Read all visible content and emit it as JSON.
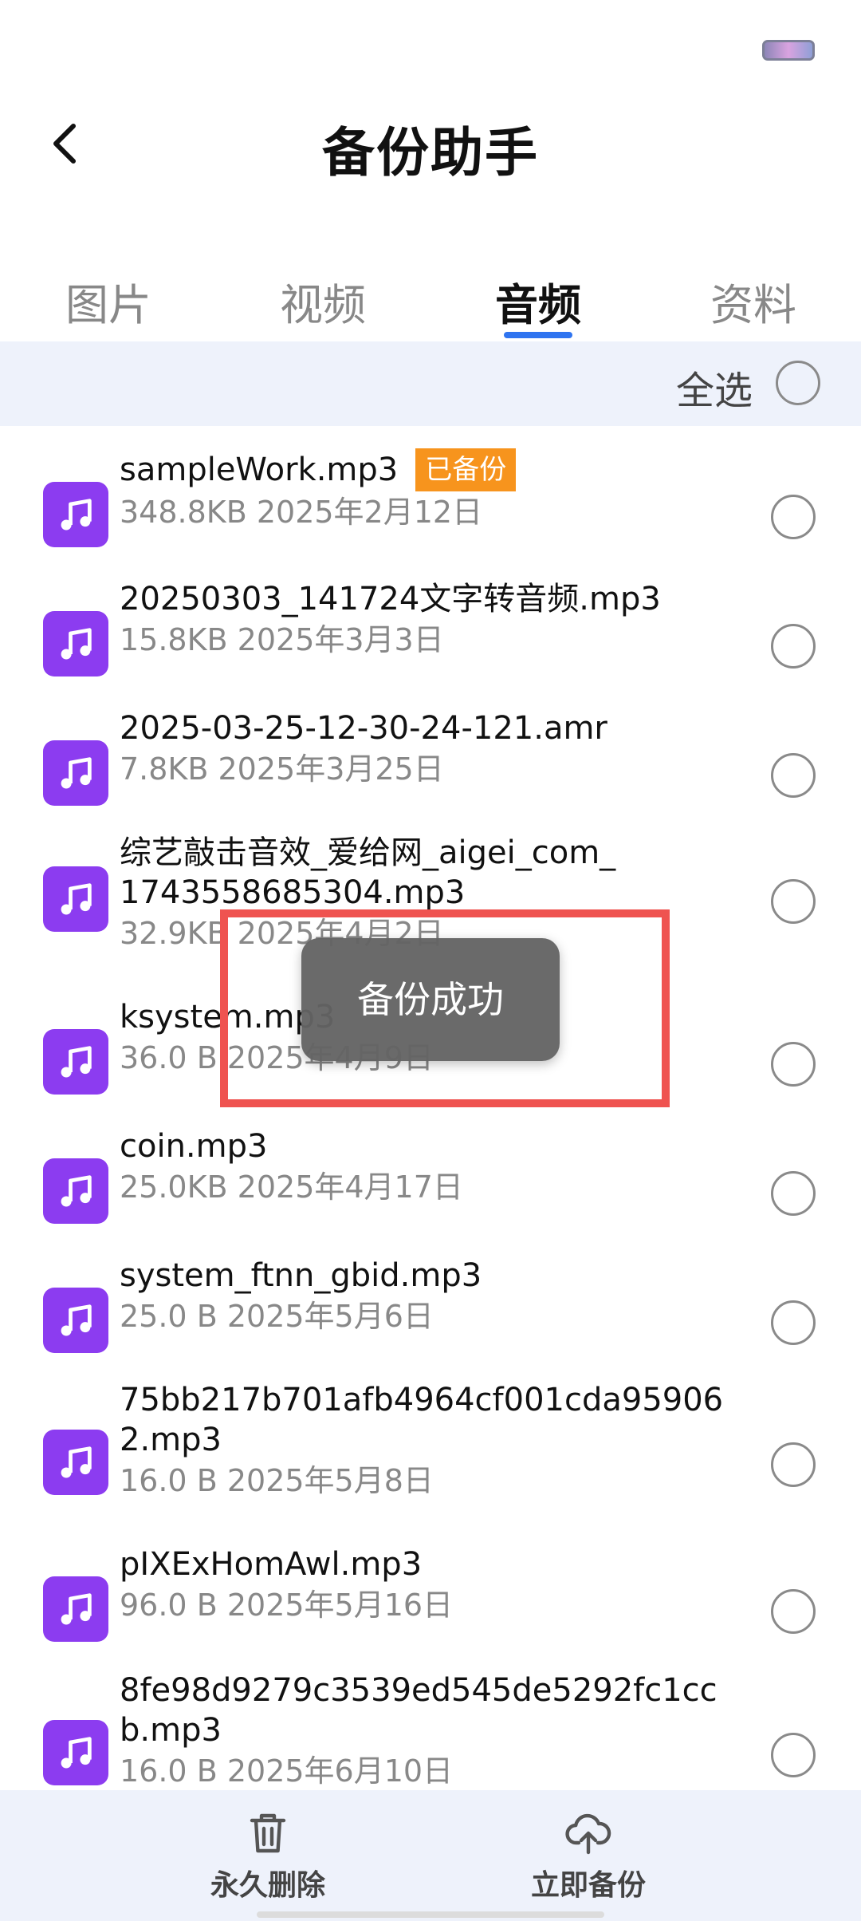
{
  "header": {
    "title": "备份助手"
  },
  "tabs": [
    {
      "label": "图片",
      "active": false
    },
    {
      "label": "视频",
      "active": false
    },
    {
      "label": "音频",
      "active": true
    },
    {
      "label": "资料",
      "active": false
    }
  ],
  "select_all": {
    "label": "全选"
  },
  "files": [
    {
      "name": "sampleWork.mp3",
      "meta": "348.8KB 2025年2月12日",
      "badge": "已备份"
    },
    {
      "name": "20250303_141724文字转音频.mp3",
      "meta": "15.8KB 2025年3月3日"
    },
    {
      "name": "2025-03-25-12-30-24-121.amr",
      "meta": "7.8KB 2025年3月25日"
    },
    {
      "name": "综艺敲击音效_爱给网_aigei_com_1743558685304.mp3",
      "meta": "32.9KB 2025年4月2日"
    },
    {
      "name": "ksystem.mp3",
      "meta": "36.0 B 2025年4月9日"
    },
    {
      "name": "coin.mp3",
      "meta": "25.0KB 2025年4月17日"
    },
    {
      "name": "system_ftnn_gbid.mp3",
      "meta": "25.0 B 2025年5月6日"
    },
    {
      "name": "75bb217b701afb4964cf001cda959062.mp3",
      "meta": "16.0 B 2025年5月8日"
    },
    {
      "name": "pIXExHomAwl.mp3",
      "meta": "96.0 B 2025年5月16日"
    },
    {
      "name": "8fe98d9279c3539ed545de5292fc1ccb.mp3",
      "meta": "16.0 B 2025年6月10日"
    }
  ],
  "toast": {
    "message": "备份成功"
  },
  "bottom_actions": {
    "delete_label": "永久删除",
    "backup_label": "立即备份"
  },
  "colors": {
    "accent": "#2f74f0",
    "file_icon": "#8c3cf0",
    "badge": "#f7941d",
    "highlight_frame": "#ef5350"
  }
}
